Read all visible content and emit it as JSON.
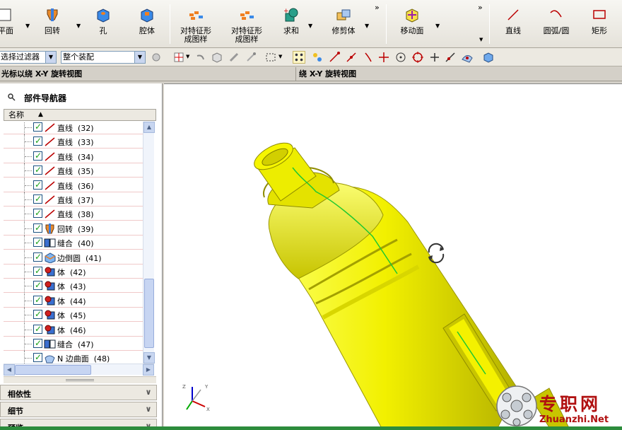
{
  "ribbon": {
    "items": [
      {
        "label": "平面",
        "icon": "plane-icon"
      },
      {
        "label": "回转",
        "icon": "revolve-icon"
      },
      {
        "label": "孔",
        "icon": "hole-icon"
      },
      {
        "label": "腔体",
        "icon": "pocket-icon"
      },
      {
        "label": "对特征形",
        "label2": "成图样",
        "icon": "pattern-feature-icon"
      },
      {
        "label": "对特征形",
        "label2": "成图样",
        "icon": "pattern-feature-icon"
      },
      {
        "label": "求和",
        "icon": "unite-icon"
      },
      {
        "label": "修剪体",
        "icon": "trim-body-icon"
      },
      {
        "label": "移动面",
        "icon": "move-face-icon"
      },
      {
        "label": "直线",
        "icon": "line-icon"
      },
      {
        "label": "圆弧/圆",
        "icon": "arc-icon"
      },
      {
        "label": "矩形",
        "icon": "rectangle-icon"
      }
    ],
    "more": "»"
  },
  "toolbar": {
    "filter_value": "选择过滤器",
    "assembly_value": "整个装配"
  },
  "status": {
    "left": "光标以绕 X-Y 旋转视图",
    "right": "绕 X-Y 旋转视图"
  },
  "navigator": {
    "title": "部件导航器",
    "column_name": "名称",
    "sort_indicator": "▲",
    "rows": [
      {
        "label": "直线",
        "num": "(32)",
        "icon": "line-icon"
      },
      {
        "label": "直线",
        "num": "(33)",
        "icon": "line-icon"
      },
      {
        "label": "直线",
        "num": "(34)",
        "icon": "line-icon"
      },
      {
        "label": "直线",
        "num": "(35)",
        "icon": "line-icon"
      },
      {
        "label": "直线",
        "num": "(36)",
        "icon": "line-icon"
      },
      {
        "label": "直线",
        "num": "(37)",
        "icon": "line-icon"
      },
      {
        "label": "直线",
        "num": "(38)",
        "icon": "line-icon"
      },
      {
        "label": "回转",
        "num": "(39)",
        "icon": "revolve-icon"
      },
      {
        "label": "缝合",
        "num": "(40)",
        "icon": "sew-icon"
      },
      {
        "label": "边倒圆",
        "num": "(41)",
        "icon": "edge-blend-icon"
      },
      {
        "label": "体",
        "num": "(42)",
        "icon": "body-icon"
      },
      {
        "label": "体",
        "num": "(43)",
        "icon": "body-icon"
      },
      {
        "label": "体",
        "num": "(44)",
        "icon": "body-icon"
      },
      {
        "label": "体",
        "num": "(45)",
        "icon": "body-icon"
      },
      {
        "label": "体",
        "num": "(46)",
        "icon": "body-icon"
      },
      {
        "label": "缝合",
        "num": "(47)",
        "icon": "sew-icon"
      },
      {
        "label": "N 边曲面",
        "num": "(48)",
        "icon": "n-sided-surface-icon"
      }
    ],
    "panels": [
      "相依性",
      "细节",
      "预览"
    ]
  },
  "watermark": {
    "title": "专职网",
    "url": "Zhuanzhi.Net"
  },
  "colors": {
    "model": "#f2f000",
    "model_shade": "#c9c600",
    "edge_curve": "#22c832",
    "brand": "#b01010"
  }
}
